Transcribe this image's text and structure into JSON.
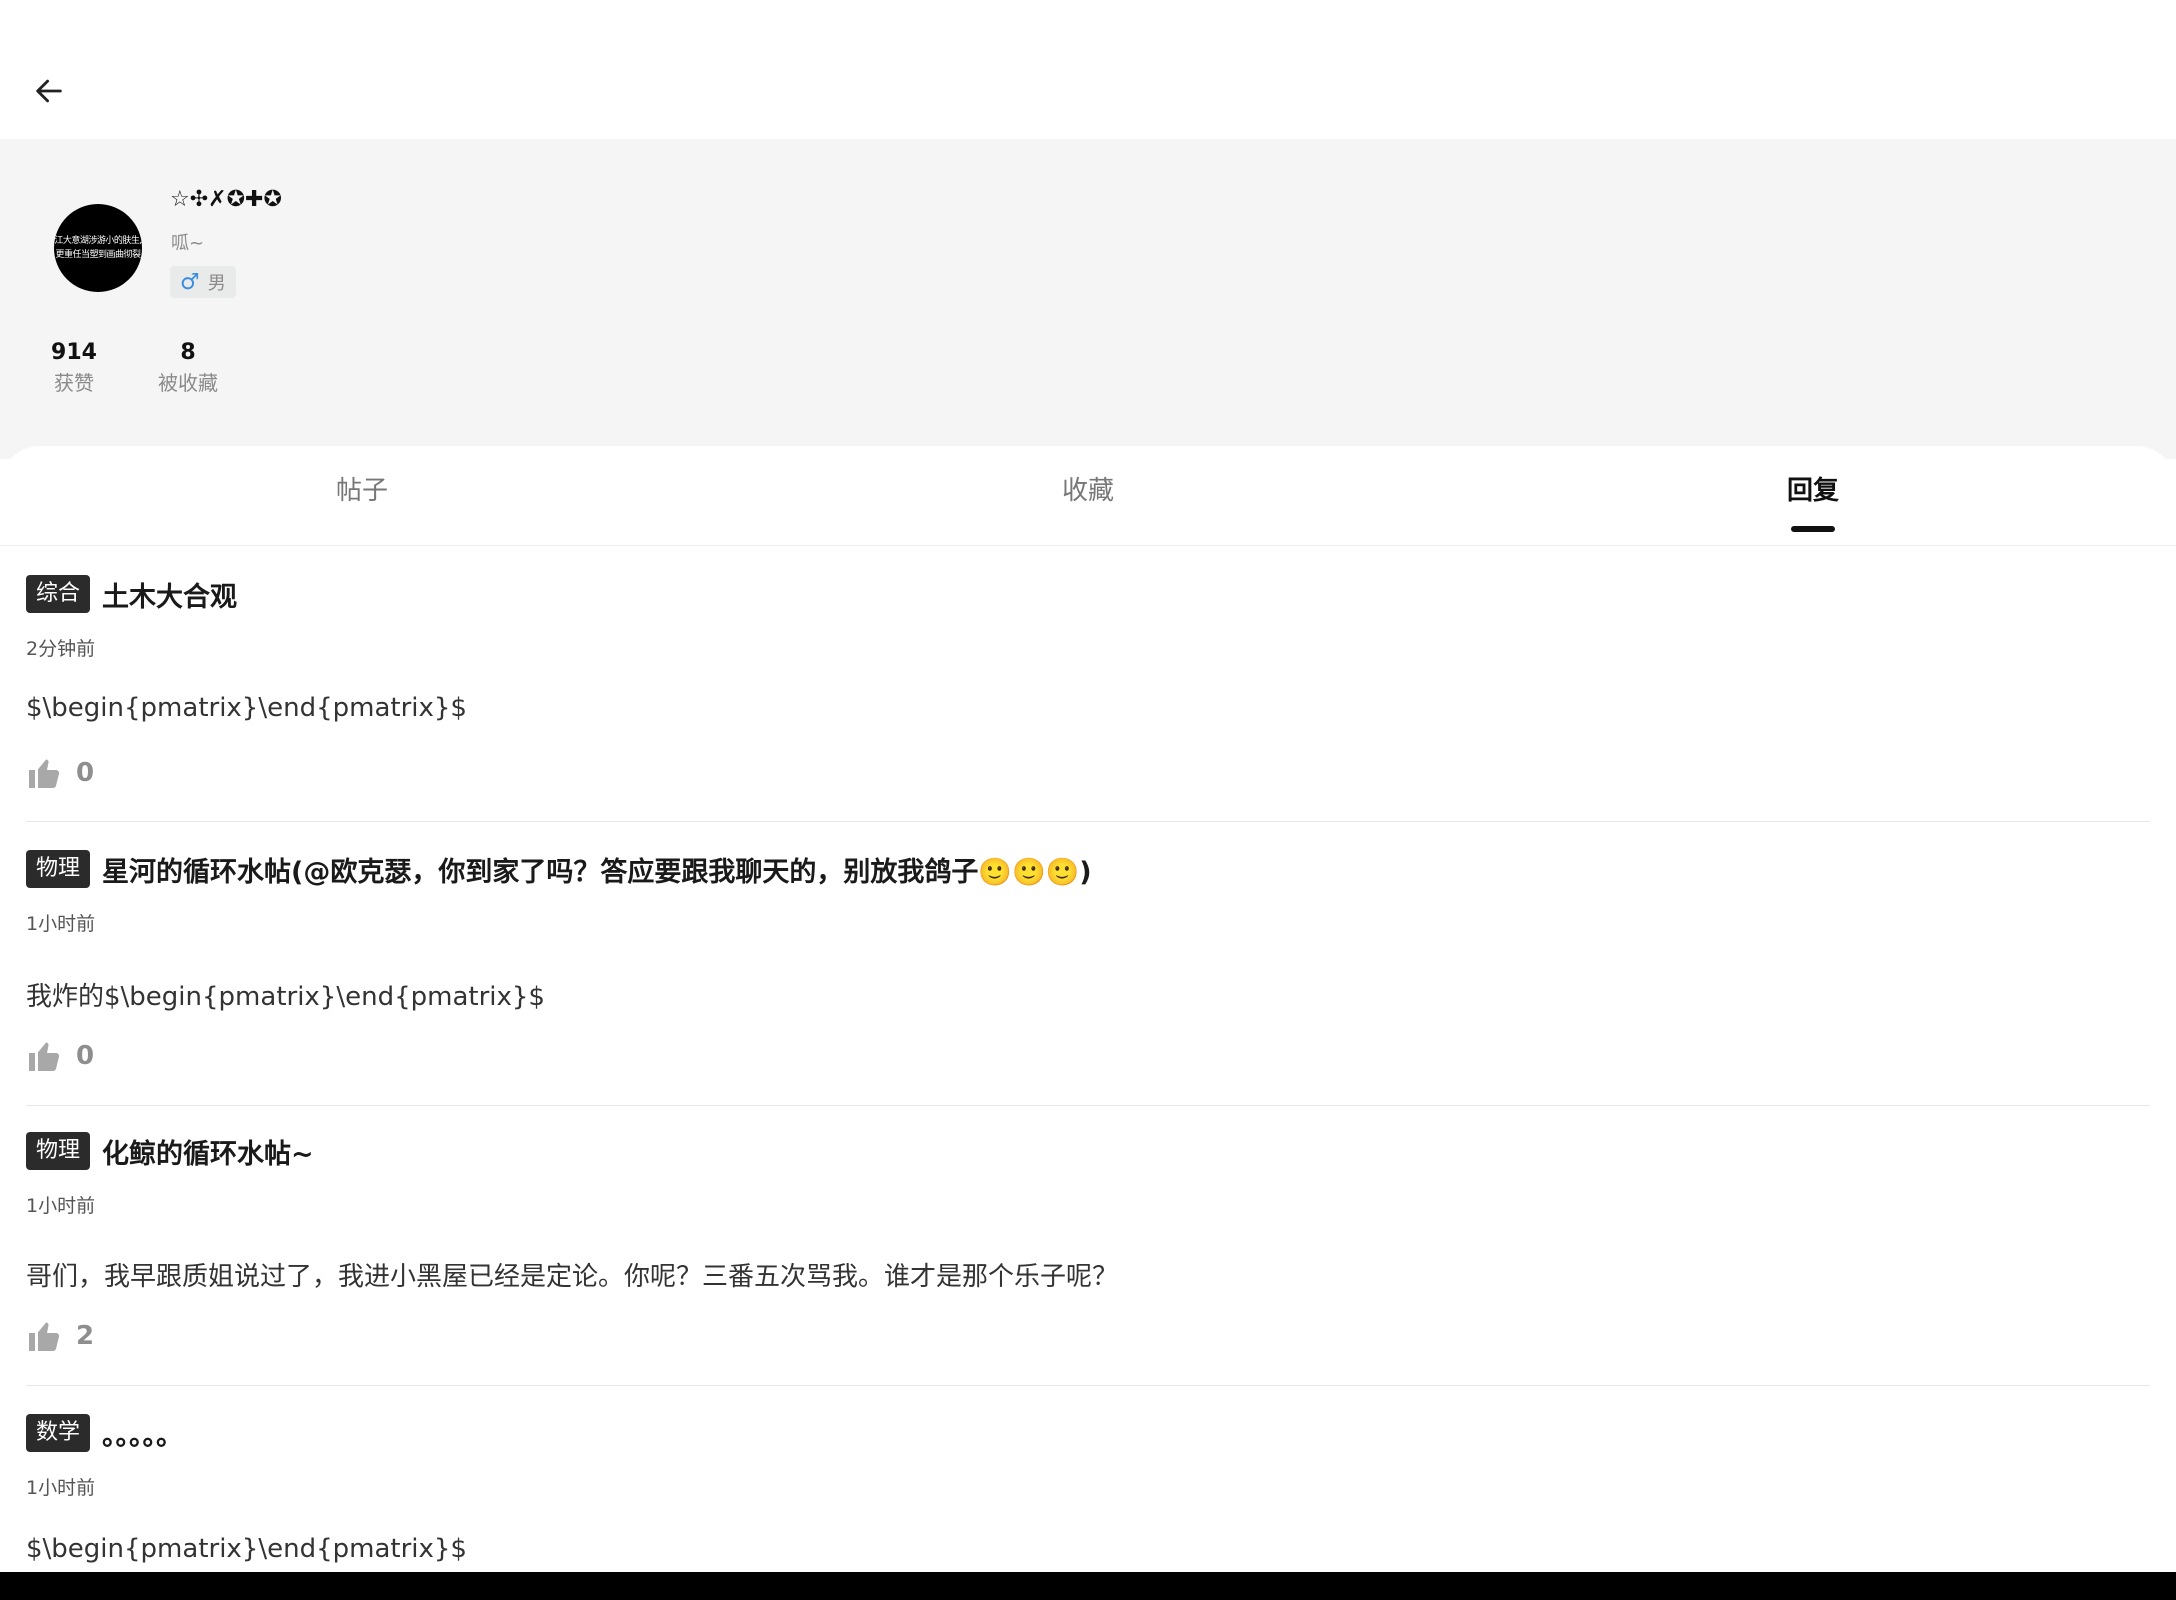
{
  "header": {
    "back_icon": "arrow-left-icon"
  },
  "profile": {
    "avatar_lines": [
      "江大意湖涉游小的肤生,",
      "更重任当塑到画曲彻裂"
    ],
    "username": "☆✣✗✪✚✪",
    "bio": "呱~",
    "gender_symbol": "♂",
    "gender_label": "男",
    "stats": [
      {
        "value": "914",
        "label": "获赞"
      },
      {
        "value": "8",
        "label": "被收藏"
      }
    ]
  },
  "tabs": [
    {
      "label": "帖子",
      "active": false
    },
    {
      "label": "收藏",
      "active": false
    },
    {
      "label": "回复",
      "active": true
    }
  ],
  "replies": [
    {
      "category": "综合",
      "title": "土木大合观",
      "time": "2分钟前",
      "text": "$\\begin{pmatrix}\\end{pmatrix}$",
      "likes": "0"
    },
    {
      "category": "物理",
      "title": "星河的循环水帖(@欧克瑟，你到家了吗？答应要跟我聊天的，别放我鸽子🙂🙂🙂)",
      "time": "1小时前",
      "text": "我炸的$\\begin{pmatrix}\\end{pmatrix}$",
      "likes": "0"
    },
    {
      "category": "物理",
      "title": "化鲸的循环水帖~",
      "time": "1小时前",
      "text": "哥们，我早跟质姐说过了，我进小黑屋已经是定论。你呢？三番五次骂我。谁才是那个乐子呢？",
      "likes": "2"
    },
    {
      "category": "数学",
      "title": "。。。。。",
      "time": "1小时前",
      "text": "$\\begin{pmatrix}\\end{pmatrix}$",
      "likes": ""
    }
  ],
  "colors": {
    "badge_bg": "#2b2b2b",
    "profile_bg": "#f4f5f4",
    "male_blue": "#3b8de0"
  },
  "icons": {
    "like": "thumbs-up-icon",
    "gender": "male-icon"
  }
}
